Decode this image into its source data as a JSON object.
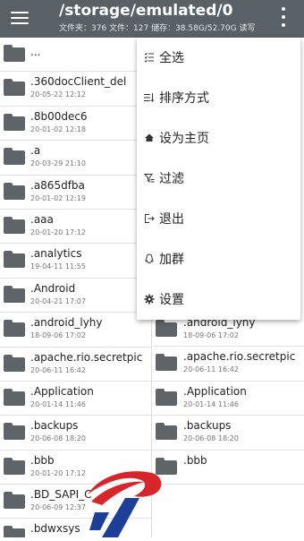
{
  "header": {
    "path": "/storage/emulated/0",
    "stats": "文件夹：376 文件：127  储存：38.58G/52.70G  读写",
    "menu_icon": "hamburger-icon",
    "overflow_icon": "more-vert-icon"
  },
  "left_items": [
    {
      "name": "...",
      "date": ""
    },
    {
      "name": ".360docClient_del",
      "date": "20-05-22 12:12"
    },
    {
      "name": ".8b00dec6",
      "date": "20-01-02 12:18"
    },
    {
      "name": ".a",
      "date": "20-03-29 21:10"
    },
    {
      "name": ".a865dfba",
      "date": "20-01-02 12:19"
    },
    {
      "name": ".aaa",
      "date": "20-01-20 17:12"
    },
    {
      "name": ".analytics",
      "date": "19-04-11 11:55"
    },
    {
      "name": ".Android",
      "date": "20-04-21 17:07"
    },
    {
      "name": ".android_lyhy",
      "date": "18-09-06 17:02"
    },
    {
      "name": ".apache.rio.secretpic",
      "date": "20-06-11 16:42"
    },
    {
      "name": ".Application",
      "date": "20-01-14 11:46"
    },
    {
      "name": ".backups",
      "date": "20-06-08 18:20"
    },
    {
      "name": ".bbb",
      "date": "20-01-20 17:12"
    },
    {
      "name": ".BD_SAPI_C",
      "date": "20-06-09 12:37"
    },
    {
      "name": ".bdwxsys",
      "date": ""
    }
  ],
  "right_items": [
    {
      "name": ".android_lyhy",
      "date": "18-09-06 17:02"
    },
    {
      "name": ".apache.rio.secretpic",
      "date": "20-06-11 16:42"
    },
    {
      "name": ".Application",
      "date": "20-01-14 11:46"
    },
    {
      "name": ".backups",
      "date": "20-06-08 18:20"
    },
    {
      "name": ".bbb",
      "date": ""
    }
  ],
  "menu": [
    {
      "label": "全选",
      "icon": "select-all-icon"
    },
    {
      "label": "排序方式",
      "icon": "sort-icon"
    },
    {
      "label": "设为主页",
      "icon": "home-icon"
    },
    {
      "label": "过滤",
      "icon": "filter-icon"
    },
    {
      "label": "退出",
      "icon": "exit-icon"
    },
    {
      "label": "加群",
      "icon": "qq-icon"
    },
    {
      "label": "设置",
      "icon": "settings-gear-icon"
    }
  ],
  "colors": {
    "topbar": "#5a6166",
    "folder": "#5f6468",
    "logo_red": "#d7262b",
    "logo_blue": "#1d3f97"
  },
  "watermark_logo": "logo"
}
